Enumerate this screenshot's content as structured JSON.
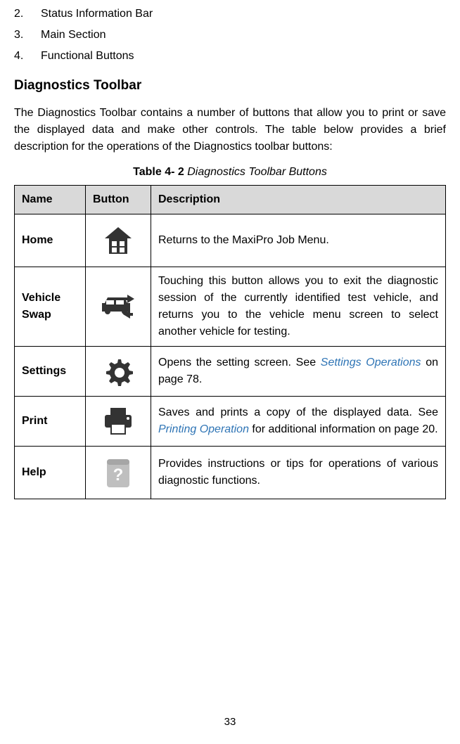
{
  "list": {
    "item2": {
      "num": "2.",
      "text": "Status Information Bar"
    },
    "item3": {
      "num": "3.",
      "text": "Main Section"
    },
    "item4": {
      "num": "4.",
      "text": "Functional Buttons"
    }
  },
  "heading": "Diagnostics Toolbar",
  "paragraph": "The Diagnostics Toolbar contains a number of buttons that allow you to print or save the displayed data and make other controls. The table below provides a brief description for the operations of the Diagnostics toolbar buttons:",
  "table_caption": {
    "label": "Table 4- 2",
    "title": " Diagnostics Toolbar Buttons"
  },
  "table": {
    "headers": {
      "name": "Name",
      "button": "Button",
      "description": "Description"
    },
    "rows": {
      "home": {
        "name": "Home",
        "desc": "Returns to the MaxiPro Job Menu."
      },
      "vehicle_swap": {
        "name": "Vehicle Swap",
        "desc": "Touching this button allows you to exit the diagnostic session of the currently identified test vehicle, and returns you to the vehicle menu screen to select another vehicle for testing."
      },
      "settings": {
        "name": "Settings",
        "desc_pre": "Opens the setting screen. See ",
        "link": "Settings Operations",
        "desc_post": " on page 78."
      },
      "print": {
        "name": "Print",
        "desc_pre": "Saves and prints a copy of the displayed data. See ",
        "link": "Printing Operation",
        "desc_post": " for additional information on page 20."
      },
      "help": {
        "name": "Help",
        "desc": "Provides instructions or tips for operations of various diagnostic functions."
      }
    }
  },
  "page_number": "33"
}
